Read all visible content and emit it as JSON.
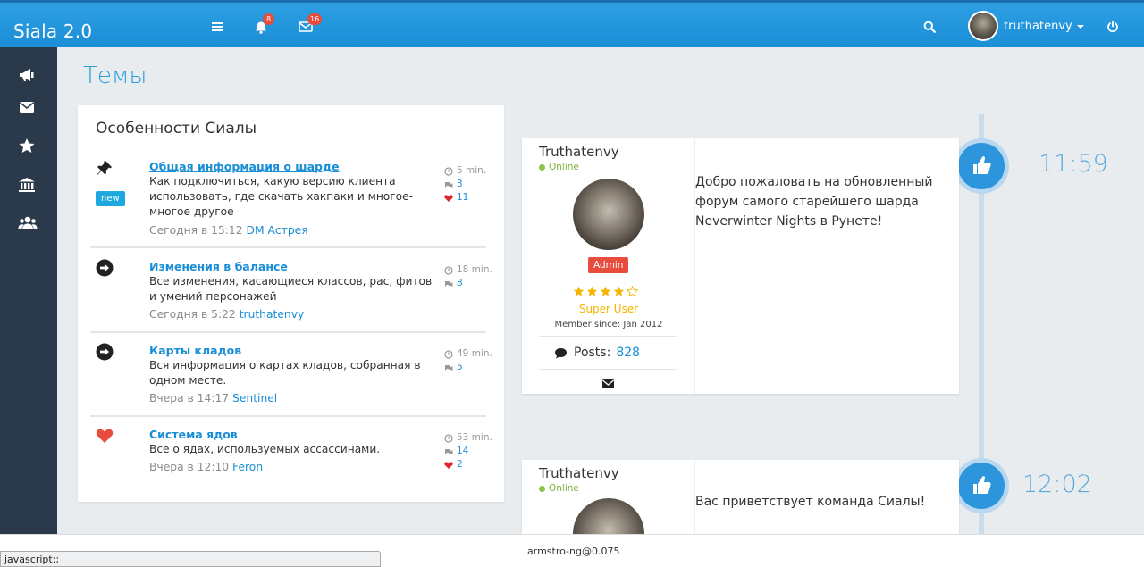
{
  "header": {
    "brand": "Siala 2.0",
    "notifications_count": "8",
    "messages_count": "16",
    "username": "truthatenvy"
  },
  "sidebar": {
    "items": [
      "announcements",
      "messages",
      "favorites",
      "institutions",
      "groups"
    ]
  },
  "page": {
    "title": "Темы"
  },
  "panel": {
    "title": "Особенности Сиалы",
    "new_label": "new",
    "topics": [
      {
        "title": "Общая информация о шарде",
        "description": "Как подключиться, какую версию клиента использовать, где скачать хакпаки и многое-многое другое",
        "date": "Сегодня в 15:12",
        "author": "DM Астрея",
        "time": "5 min.",
        "comments": "3",
        "likes": "11"
      },
      {
        "title": "Изменения в балансе",
        "description": "Все изменения, касающиеся классов, рас, фитов и умений персонажей",
        "date": "Сегодня в 5:22",
        "author": "truthatenvy",
        "time": "18 min.",
        "comments": "8"
      },
      {
        "title": "Карты кладов",
        "description": "Вся информация о картах кладов, собранная в одном месте.",
        "date": "Вчера в 14:17",
        "author": "Sentinel",
        "time": "49 min.",
        "comments": "5"
      },
      {
        "title": "Система ядов",
        "description": "Все о ядах, используемых ассассинами.",
        "date": "Вчера в 12:10",
        "author": "Feron",
        "time": "53 min.",
        "comments": "14",
        "likes": "2"
      }
    ]
  },
  "timeline": [
    {
      "time": "11:59",
      "user": "Truthatenvy",
      "status": "Online",
      "role": "Admin",
      "rank": "Super User",
      "stars_filled": 4,
      "stars_total": 5,
      "member_since": "Member since: Jan 2012",
      "posts_label": "Posts:",
      "posts_count": "828",
      "text": "Добро пожаловать на обновленный форум самого старейшего шарда Neverwinter Nights в Рунете!"
    },
    {
      "time": "12:02",
      "user": "Truthatenvy",
      "status": "Online",
      "text": "Вас приветствует команда Сиалы!"
    }
  ],
  "footer": {
    "text": "armstro-ng@0.075",
    "status_url": "javascript:;"
  },
  "colors": {
    "accent": "#1a8ed6",
    "sidebar": "#2b3a4a",
    "danger": "#e74c3c",
    "star": "#f4b400",
    "online": "#8bc34a"
  }
}
